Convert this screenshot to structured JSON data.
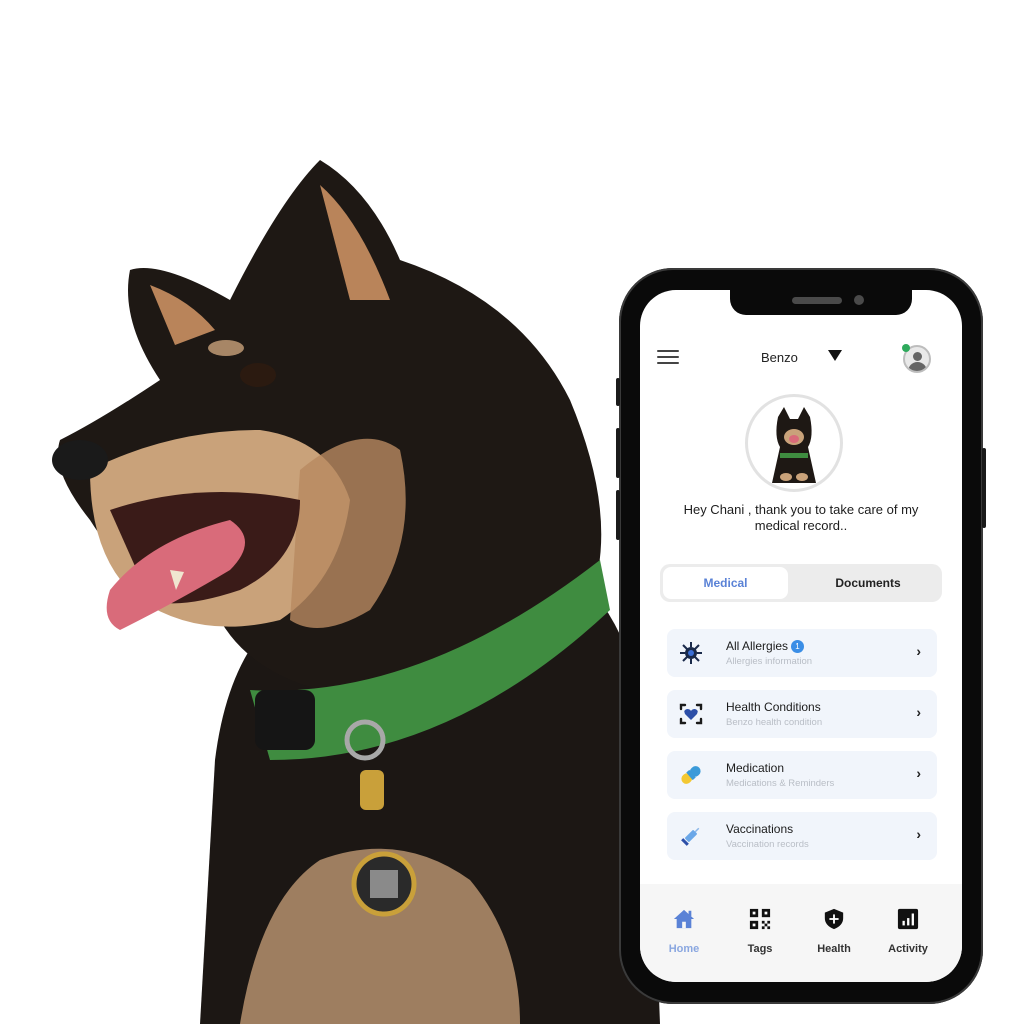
{
  "app": {
    "header": {
      "pet_name": "Benzo",
      "menu_icon": "hamburger-menu-icon",
      "dropdown_icon": "triangle-down-icon",
      "profile_icon": "user-profile-icon",
      "online_status_color": "#2eaa5c"
    },
    "greeting": "Hey Chani , thank you to take care of my medical record..",
    "tabs": [
      {
        "label": "Medical",
        "active": true
      },
      {
        "label": "Documents",
        "active": false
      }
    ],
    "accent_color": "#5a82d6",
    "cards": [
      {
        "title": "All Allergies",
        "subtitle": "Allergies information",
        "badge": "1",
        "icon": "virus-icon"
      },
      {
        "title": "Health Conditions",
        "subtitle": "Benzo health condition",
        "icon": "heart-scan-icon"
      },
      {
        "title": "Medication",
        "subtitle": "Medications & Reminders",
        "icon": "pill-icon"
      },
      {
        "title": "Vaccinations",
        "subtitle": "Vaccination records",
        "icon": "syringe-icon"
      }
    ],
    "bottom_nav": [
      {
        "label": "Home",
        "icon": "home-icon",
        "active": true
      },
      {
        "label": "Tags",
        "icon": "qr-code-icon",
        "active": false
      },
      {
        "label": "Health",
        "icon": "shield-plus-icon",
        "active": false
      },
      {
        "label": "Activity",
        "icon": "bar-chart-icon",
        "active": false
      }
    ]
  }
}
